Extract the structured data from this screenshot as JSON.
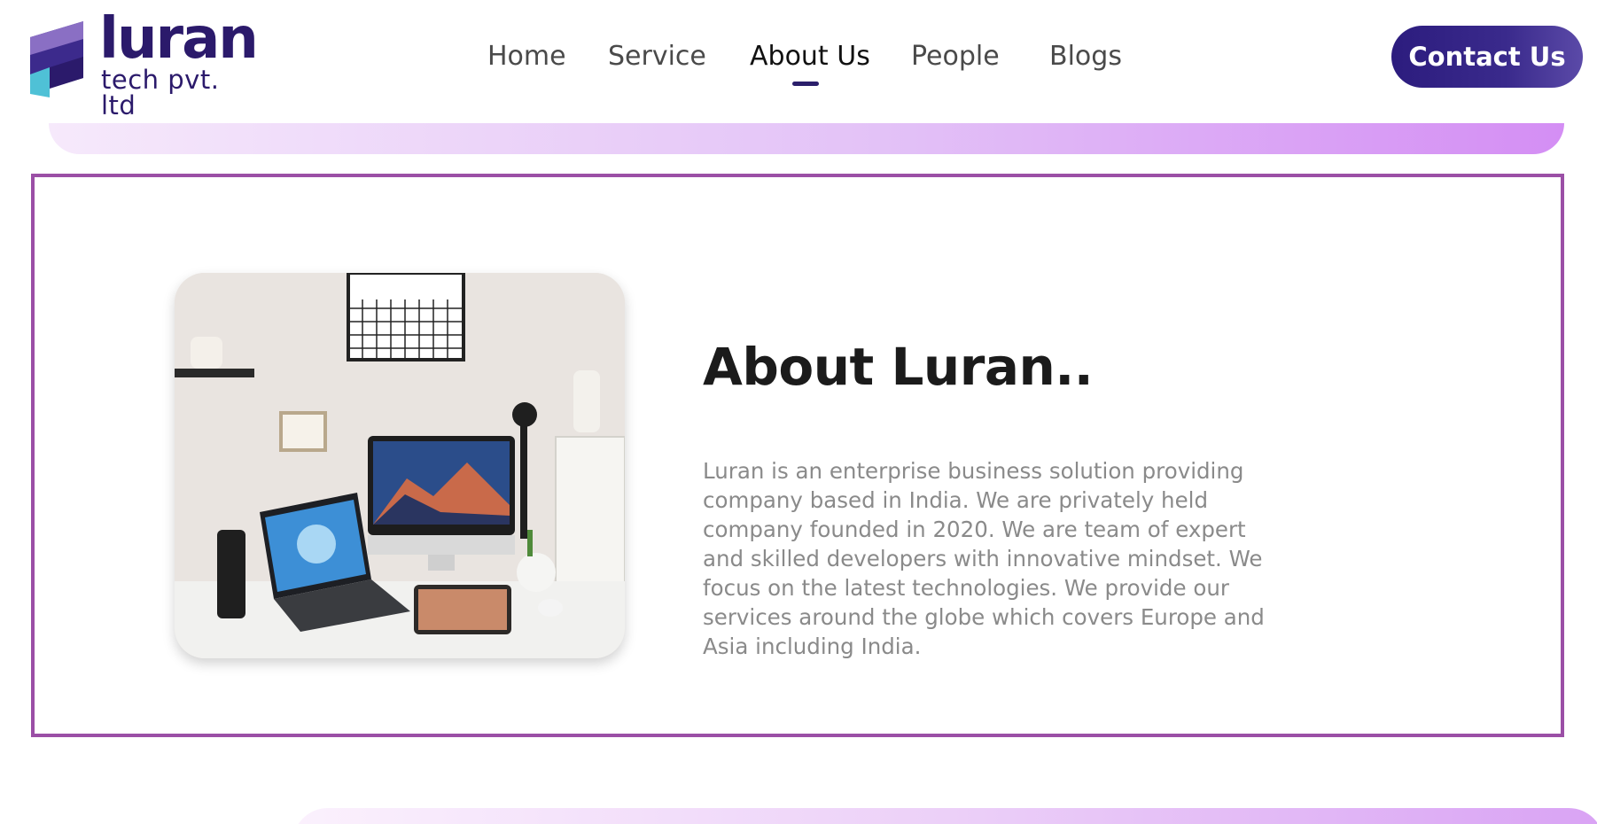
{
  "brand": {
    "name": "luran",
    "subtitle": "tech pvt. ltd",
    "primary_color": "#2b1a6b",
    "accent_color": "#4fc1d6"
  },
  "nav": {
    "items": [
      {
        "label": "Home",
        "active": false
      },
      {
        "label": "Service",
        "active": false
      },
      {
        "label": "About Us",
        "active": true
      },
      {
        "label": "People",
        "active": false
      },
      {
        "label": "Blogs",
        "active": false
      }
    ],
    "cta_label": "Contact Us"
  },
  "about": {
    "title": "About Luran..",
    "body": "Luran is an enterprise business solution providing company based in India. We are privately held company founded in 2020. We are team of expert and skilled developers with innovative mindset. We focus on the latest technologies. We provide our services around the globe which covers Europe and Asia including India.",
    "border_color": "#9b4fa6",
    "image_label": "workspace-desk-photo"
  },
  "colors": {
    "strip_gradient_start": "#f6e9fb",
    "strip_gradient_end": "#d48ef4",
    "cta_gradient_start": "#2c1c7e",
    "cta_gradient_end": "#5b4aa8"
  }
}
